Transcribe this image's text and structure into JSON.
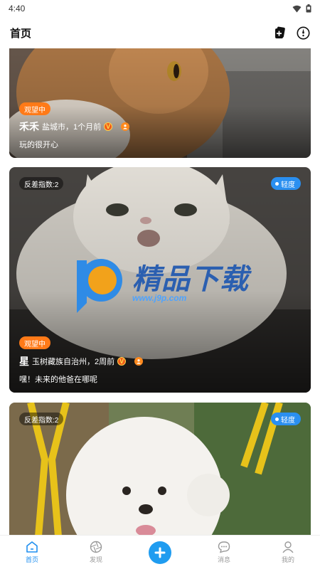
{
  "status_bar": {
    "time": "4:40"
  },
  "header": {
    "title": "首页"
  },
  "feed": {
    "cards": [
      {
        "status": "观望中",
        "name": "禾禾",
        "location_time": "盐城市，1个月前",
        "vip_badge": "V",
        "description": "玩的很开心"
      },
      {
        "index_label": "反差指数:2",
        "level": "轻度",
        "status": "观望中",
        "name": "星",
        "location_time": "玉树藏族自治州，2周前",
        "vip_badge": "V",
        "description": "嘿！未来的他爸在哪呢"
      },
      {
        "index_label": "反差指数:2",
        "level": "轻度"
      }
    ]
  },
  "watermark": {
    "text": "精品下载",
    "url": "www.j9p.com"
  },
  "tabbar": {
    "items": [
      {
        "label": "首页",
        "icon": "home-icon",
        "active": true
      },
      {
        "label": "发现",
        "icon": "aperture-icon",
        "active": false
      },
      {
        "label": "",
        "icon": "plus-icon",
        "active": false
      },
      {
        "label": "消息",
        "icon": "chat-icon",
        "active": false
      },
      {
        "label": "我的",
        "icon": "profile-icon",
        "active": false
      }
    ]
  },
  "colors": {
    "accent": "#1f8ff0",
    "status_chip": "#ff7a18",
    "level_chip": "#2a8ff0"
  }
}
